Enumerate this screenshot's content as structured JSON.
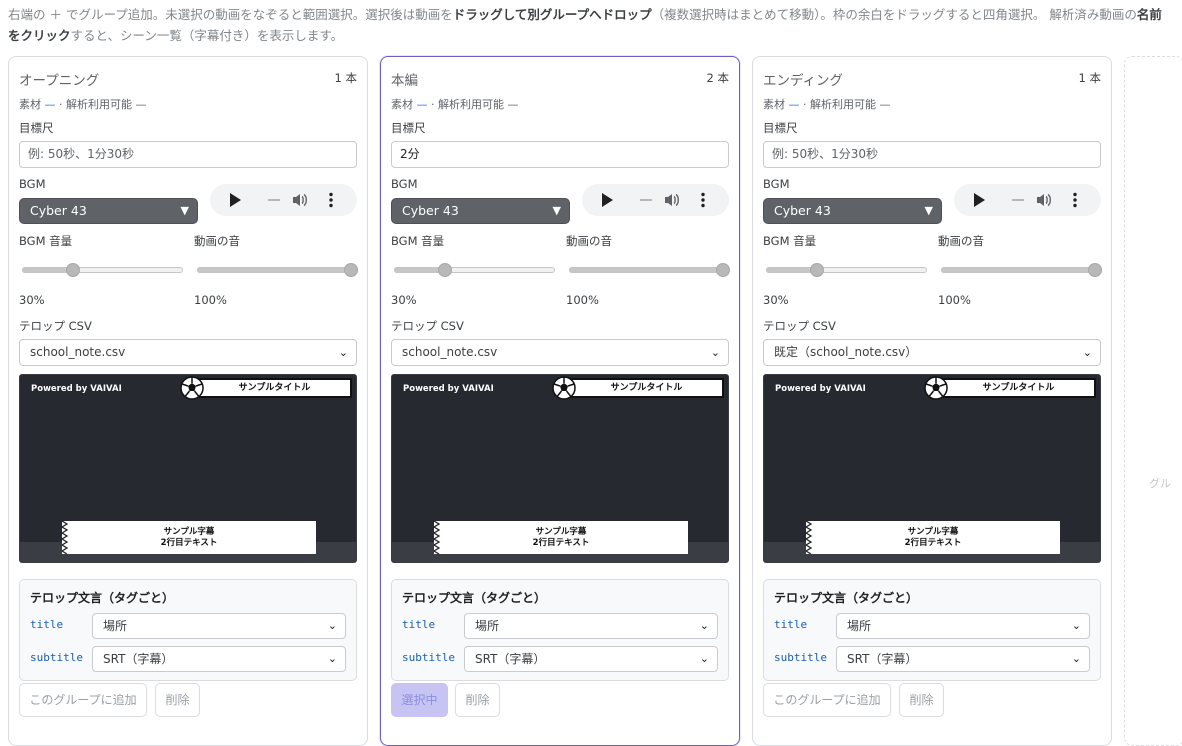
{
  "hint": {
    "p1": "右端の ＋ でグループ追加。未選択の動画をなぞると範囲選択。選択後は動画を",
    "b1": "ドラッグして別グループへドロップ",
    "p2": "（複数選択時はまとめて移動）。枠の余白をドラッグすると四角選択。 解析済み動画の",
    "b2": "名前をクリック",
    "p3": "すると、シーン一覧（字幕付き）を表示します。"
  },
  "labels": {
    "target_length": "目標尺",
    "bgm": "BGM",
    "bgm_volume": "BGM 音量",
    "video_sound": "動画の音",
    "telop_csv": "テロップ CSV",
    "telop_panel_title": "テロップ文言（タグごと）",
    "tag_title": "title",
    "tag_subtitle": "subtitle",
    "meta_material": "素材",
    "meta_dash": "—",
    "meta_analysis": "· 解析利用可能 —",
    "delete_button": "削除"
  },
  "preview": {
    "powered": "Powered by VAIVAI",
    "title_text": "サンプルタイトル",
    "sub_line1": "サンプル字幕",
    "sub_line2": "2行目テキスト"
  },
  "groups": [
    {
      "title": "オープニング",
      "count": "1 本",
      "target_value": "",
      "target_placeholder": "例: 50秒、1分30秒",
      "bgm": "Cyber 43",
      "bgm_volume": "30%",
      "bgm_volume_value": 30,
      "video_volume": "100%",
      "video_volume_value": 100,
      "csv": "school_note.csv",
      "title_tag_value": "場所",
      "subtitle_tag_value": "SRT（字幕）",
      "action_button": "このグループに追加"
    },
    {
      "title": "本編",
      "count": "2 本",
      "target_value": "2分",
      "target_placeholder": "",
      "bgm": "Cyber 43",
      "bgm_volume": "30%",
      "bgm_volume_value": 30,
      "video_volume": "100%",
      "video_volume_value": 100,
      "csv": "school_note.csv",
      "title_tag_value": "場所",
      "subtitle_tag_value": "SRT（字幕）",
      "action_button": "選択中"
    },
    {
      "title": "エンディング",
      "count": "1 本",
      "target_value": "",
      "target_placeholder": "例: 50秒、1分30秒",
      "bgm": "Cyber 43",
      "bgm_volume": "30%",
      "bgm_volume_value": 30,
      "video_volume": "100%",
      "video_volume_value": 100,
      "csv": "既定（school_note.csv）",
      "title_tag_value": "場所",
      "subtitle_tag_value": "SRT（字幕）",
      "action_button": "このグループに追加"
    }
  ],
  "ghost_group_label": "グル",
  "colors": {
    "accent": "#6f5bc9",
    "selected_button": "#c7c4f3",
    "tag_text": "#1a5fb4",
    "preview_bg": "#262a30"
  }
}
